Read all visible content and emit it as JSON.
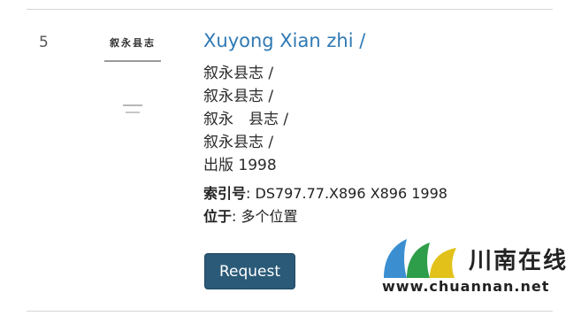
{
  "result": {
    "index": "5",
    "title": "Xuyong Xian zhi /",
    "lines": [
      "叙永县志 /",
      "叙永县志 /",
      "叙永　县志 /",
      "叙永县志 /",
      "出版 1998"
    ],
    "call_number": {
      "label": "索引号",
      "value": ": DS797.77.X896 X896 1998"
    },
    "location": {
      "label": "位于",
      "value": ": 多个位置"
    },
    "request_label": "Request",
    "cover": {
      "title": "叙永县志"
    }
  },
  "watermark": {
    "name": "川南在线",
    "url": "www.chuannan.net",
    "colors": [
      "#3b8fd0",
      "#2e9e4a",
      "#e2c21a"
    ]
  }
}
